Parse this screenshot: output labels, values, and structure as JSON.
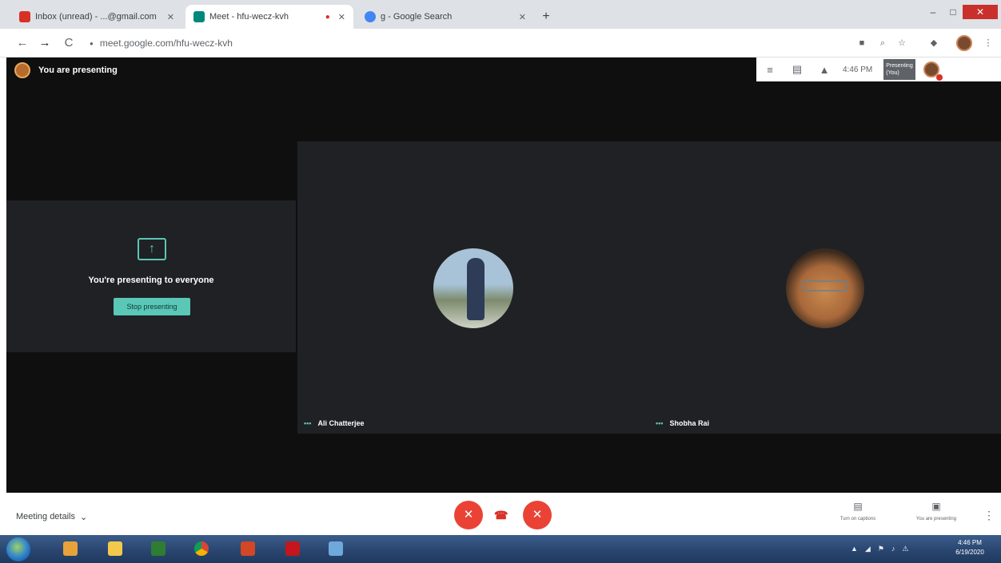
{
  "browser": {
    "tabs": [
      {
        "label": "Inbox (unread) - ...@gmail.com",
        "favicon_color": "#d93025",
        "active": false
      },
      {
        "label": "Meet - hfu-wecz-kvh",
        "favicon_color": "#00897b",
        "active": true
      },
      {
        "label": "g - Google Search",
        "favicon_color": "#4285f4",
        "active": false
      }
    ],
    "new_tab_glyph": "+",
    "window_controls": {
      "minimize": "–",
      "maximize": "□",
      "close": "✕"
    },
    "nav": {
      "back": "←",
      "forward": "→",
      "reload": "C"
    },
    "address": "meet.google.com/hfu-wecz-kvh",
    "lock_glyph": "●",
    "extension_icons": [
      "camera-icon",
      "zoom-icon",
      "star-icon",
      "extensions-icon"
    ],
    "menu_glyph": "⋮"
  },
  "meet": {
    "presenting_label": "You are presenting",
    "top_icons": [
      "people-icon",
      "chat-icon",
      "activities-icon"
    ],
    "time": "4:46 PM",
    "presentation_thumb_label": "Presenting (You)",
    "share_message": "You're presenting to everyone",
    "stop_presenting_label": "Stop presenting",
    "participants": [
      {
        "name": "Ali Chatterjee"
      },
      {
        "name": "Shobha Rai"
      }
    ],
    "accent_color": "#5ac7b7"
  },
  "controls": {
    "meeting_details": "Meeting details",
    "meeting_details_chevron": "⌄",
    "mic_glyph": "✕",
    "hangup_glyph": "☎",
    "camera_glyph": "✕",
    "captions": {
      "icon": "▤",
      "label": "Turn on captions"
    },
    "presenting": {
      "icon": "▣",
      "label": "You are presenting"
    },
    "more_glyph": "⋮"
  },
  "taskbar": {
    "apps": [
      "media-player-icon",
      "file-explorer-icon",
      "excel-icon",
      "chrome-icon",
      "powerpoint-icon",
      "acrobat-icon",
      "remote-desktop-icon"
    ],
    "tray": [
      "▲",
      "◢",
      "⚑",
      "♪",
      "⚠"
    ],
    "clock_time": "4:46 PM",
    "clock_date": "6/19/2020"
  }
}
